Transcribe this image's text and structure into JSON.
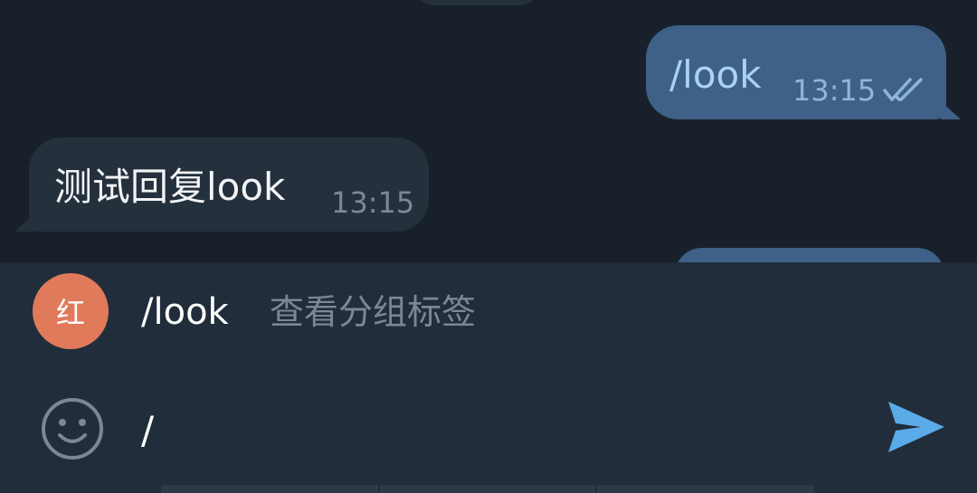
{
  "messages": [
    {
      "direction": "outgoing",
      "text": "/look",
      "time": "13:15",
      "status_icon": "double-check-icon"
    },
    {
      "direction": "incoming",
      "text": "测试回复look",
      "time": "13:15"
    }
  ],
  "command_suggestion": {
    "avatar_text": "红",
    "avatar_color": "#e07a5a",
    "command": "/look",
    "description": "查看分组标签"
  },
  "composer": {
    "value": "/",
    "emoji_icon": "emoji-icon",
    "send_icon": "send-icon"
  },
  "colors": {
    "background": "#18212b",
    "outgoing_bubble": "#3f6187",
    "incoming_bubble": "#24303c",
    "panel": "#212d3b",
    "accent": "#5aabe8"
  }
}
